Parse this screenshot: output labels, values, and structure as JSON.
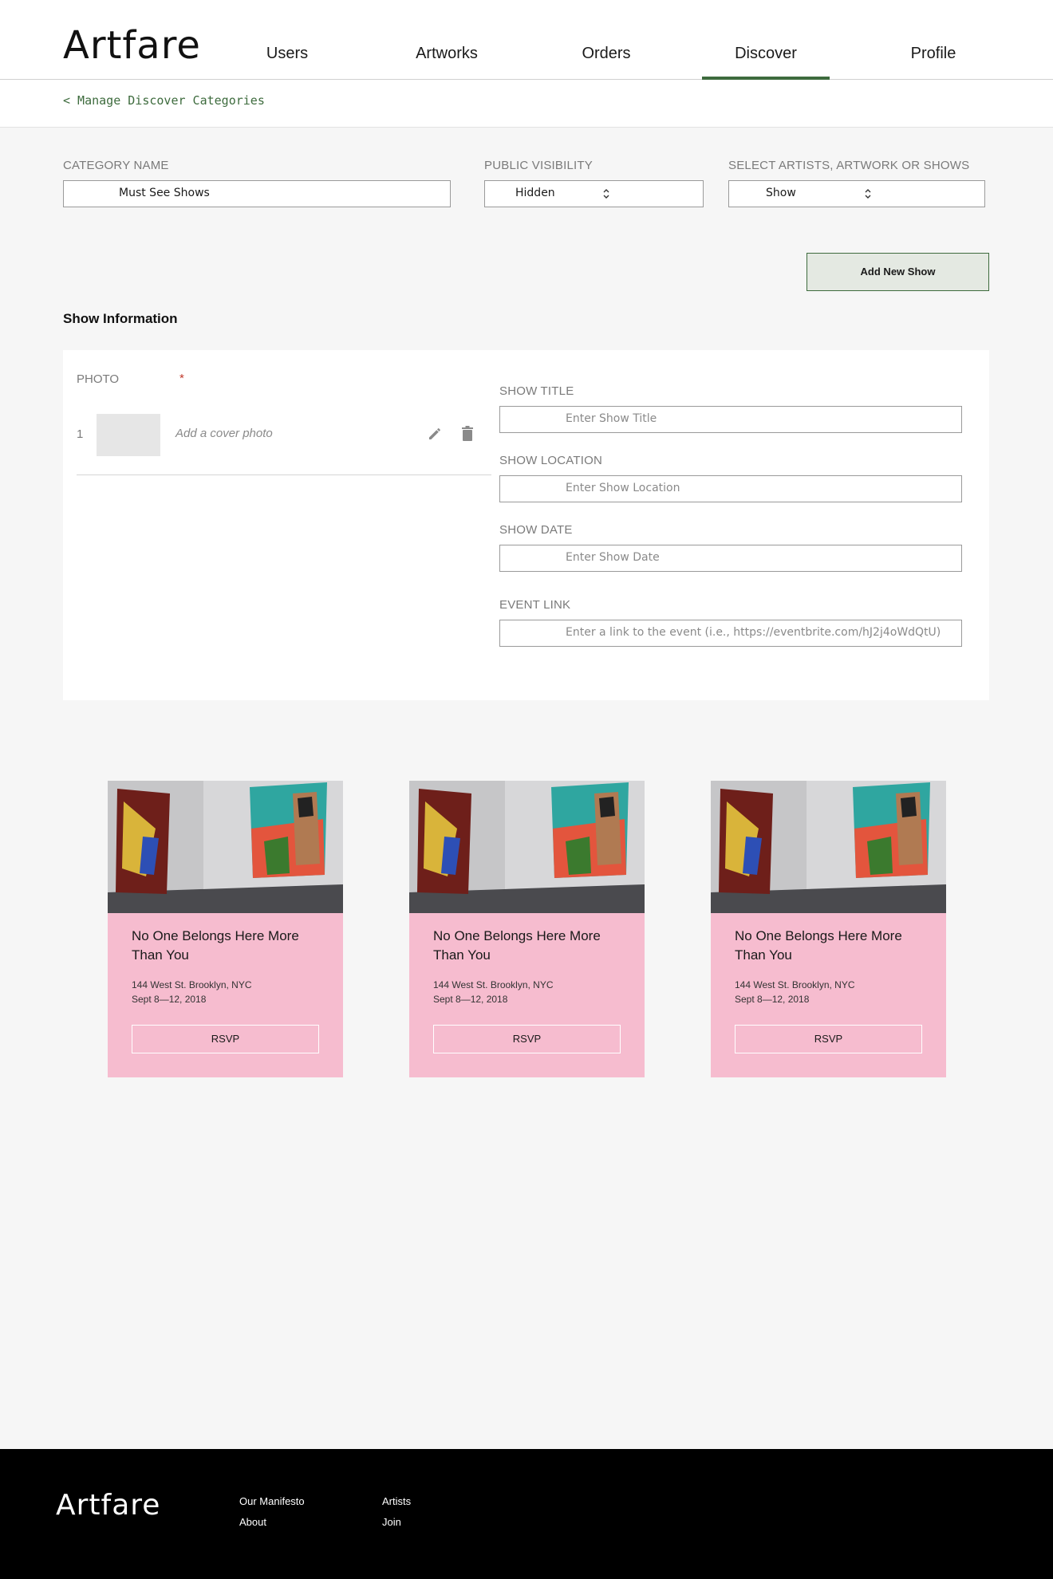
{
  "brand": {
    "logo": "Artfare"
  },
  "nav": {
    "users": "Users",
    "artworks": "Artworks",
    "orders": "Orders",
    "discover": "Discover",
    "profile": "Profile",
    "active": "Discover"
  },
  "breadcrumb": "< Manage Discover Categories",
  "form": {
    "category_name_label": "CATEGORY NAME",
    "category_name_value": "Must See Shows",
    "visibility_label": "PUBLIC VISIBILITY",
    "visibility_value": "Hidden",
    "select_label": "SELECT ARTISTS, ARTWORK OR SHOWS",
    "select_value": "Show"
  },
  "add_button": "Add New Show",
  "show_info": {
    "section_title": "Show Information",
    "photo_label": "PHOTO",
    "required_mark": "*",
    "photo_row_number": "1",
    "cover_placeholder": "Add a cover photo",
    "title_label": "SHOW TITLE",
    "title_placeholder": "Enter Show Title",
    "location_label": "SHOW LOCATION",
    "location_placeholder": "Enter Show Location",
    "date_label": "SHOW DATE",
    "date_placeholder": "Enter Show Date",
    "link_label": "EVENT LINK",
    "link_placeholder": "Enter a link to the event (i.e., https://eventbrite.com/hJ2j4oWdQtU)"
  },
  "cards": [
    {
      "title": "No One Belongs Here More Than You",
      "address": "144 West St. Brooklyn, NYC",
      "date": "Sept 8—12, 2018",
      "rsvp": "RSVP"
    },
    {
      "title": "No One Belongs Here More Than You",
      "address": "144 West St. Brooklyn, NYC",
      "date": "Sept 8—12, 2018",
      "rsvp": "RSVP"
    },
    {
      "title": "No One Belongs Here More Than You",
      "address": "144 West St. Brooklyn, NYC",
      "date": "Sept 8—12, 2018",
      "rsvp": "RSVP"
    }
  ],
  "footer": {
    "logo": "Artfare",
    "links": [
      "Our Manifesto",
      "About",
      "Artists",
      "Join"
    ]
  },
  "colors": {
    "accent": "#3d6b3d",
    "card_bg": "#f6bccf",
    "footer_bg": "#000000",
    "required": "#c0392b"
  },
  "icons": [
    "pencil-icon",
    "trash-icon",
    "chevron-up-down-icon"
  ]
}
